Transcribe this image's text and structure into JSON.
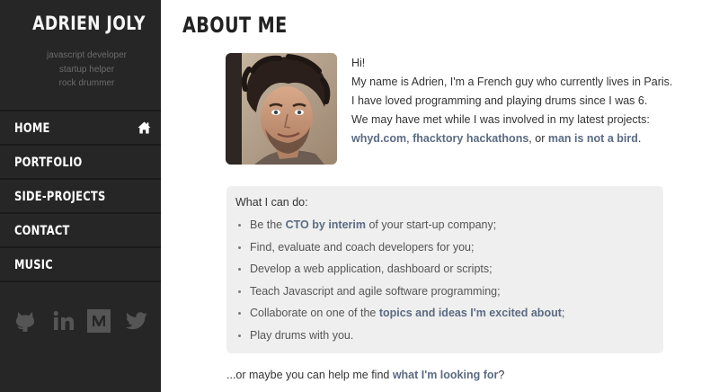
{
  "sidebar": {
    "brand": "ADRIEN JOLY",
    "taglines": [
      "javascript developer",
      "startup helper",
      "rock drummer"
    ],
    "nav": [
      {
        "label": "HOME",
        "icon": "home-icon"
      },
      {
        "label": "PORTFOLIO"
      },
      {
        "label": "SIDE-PROJECTS"
      },
      {
        "label": "CONTACT"
      },
      {
        "label": "MUSIC"
      }
    ],
    "socials": [
      "github-icon",
      "linkedin-icon",
      "medium-icon",
      "twitter-icon"
    ]
  },
  "main": {
    "title": "ABOUT ME",
    "intro": {
      "greeting": "Hi!",
      "line1": "My name is Adrien, I'm a French guy who currently lives in Paris.",
      "line2": "I have loved programming and playing drums since I was 6.",
      "line3": "We may have met while I was involved in my latest projects:",
      "project1": "whyd.com",
      "sep1": ", ",
      "project2": "fhacktory hackathons",
      "sep2": ", or ",
      "project3": "man is not a bird",
      "end": "."
    },
    "card": {
      "title": "What I can do:",
      "items": [
        {
          "pre": "Be the ",
          "link": "CTO by interim",
          "post": " of your start-up company;"
        },
        {
          "pre": "Find, evaluate and coach developers for you;"
        },
        {
          "pre": "Develop a web application, dashboard or scripts;"
        },
        {
          "pre": "Teach Javascript and agile software programming;"
        },
        {
          "pre": "Collaborate on one of the ",
          "link": "topics and ideas I'm excited about",
          "post": ";"
        },
        {
          "pre": "Play drums with you."
        }
      ]
    },
    "footer": {
      "pre": "...or maybe you can help me find ",
      "link": "what I'm looking for",
      "post": "?"
    }
  },
  "colors": {
    "sidebar_bg": "#262626",
    "link": "#5b6b82",
    "card_bg": "#efefef"
  }
}
